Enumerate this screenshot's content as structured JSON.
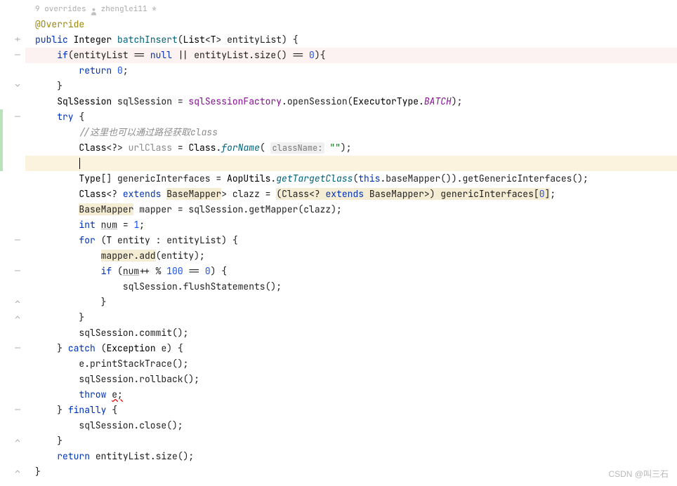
{
  "header": {
    "overrides_text": "9 overrides",
    "author": "zhenglei11 *"
  },
  "code": {
    "l1_ann": "@Override",
    "l2_kw1": "public",
    "l2_cls": "Integer",
    "l2_fn": "batchInsert",
    "l2_a": "(",
    "l2_cls2": "List",
    "l2_lt": "<",
    "l2_cls3": "T",
    "l2_gt": "> ",
    "l2_p": "entityList) {",
    "l3_a": "    ",
    "l3_kw": "if",
    "l3_b": "(entityList == ",
    "l3_null": "null",
    "l3_c": " || entityList.size() == ",
    "l3_num": "0",
    "l3_d": "){",
    "l4_a": "        ",
    "l4_kw": "return ",
    "l4_num": "0",
    "l4_sc": ";",
    "l5": "    }",
    "l6_a": "    ",
    "l6_cls": "SqlSession",
    "l6_b": " sqlSession = ",
    "l6_fld": "sqlSessionFactory",
    "l6_c": ".openSession(",
    "l6_enum": "ExecutorType",
    "l6_d": ".",
    "l6_cst": "BATCH",
    "l6_e": ");",
    "l7_a": "    ",
    "l7_kw": "try",
    "l7_b": " {",
    "l8_a": "        ",
    "l8_cmt": "//这里也可以通过路径获取class",
    "l9_a": "        ",
    "l9_cls": "Class",
    "l9_b": "<?> ",
    "l9_var": "urlClass",
    "l9_c": " = ",
    "l9_cls2": "Class",
    "l9_d": ".",
    "l9_fn": "forName",
    "l9_e": "( ",
    "l9_pn": "className:",
    "l9_sp": " ",
    "l9_str": "\"\"",
    "l9_f": ");",
    "l10_a": "        ",
    "l11_a": "        ",
    "l11_cls": "Type",
    "l11_b": "[] genericInterfaces = ",
    "l11_cls2": "AopUtils",
    "l11_c": ".",
    "l11_fn": "getTargetClass",
    "l11_d": "(",
    "l11_kw": "this",
    "l11_e": ".baseMapper()).getGenericInterfaces();",
    "l12_a": "        ",
    "l12_cls": "Class",
    "l12_b": "<? ",
    "l12_kw": "extends",
    "l12_sp": " ",
    "l12_hb": "BaseMapper",
    "l12_c": "> clazz = ",
    "l12_hb2": "(Class<? ",
    "l12_kw2": "extends",
    "l12_hb3": " BaseMapper>) genericInterfaces[",
    "l12_num": "0",
    "l12_hb4": "]",
    "l12_sc": ";",
    "l13_a": "        ",
    "l13_hb": "BaseMapper",
    "l13_b": " mapper = sqlSession.getMapper(clazz);",
    "l14_a": "        ",
    "l14_kw": "int",
    "l14_sp": " ",
    "l14_var": "num",
    "l14_b": " = ",
    "l14_num": "1",
    "l14_sc": ";",
    "l15_a": "        ",
    "l15_kw": "for",
    "l15_b": " (",
    "l15_cls": "T",
    "l15_c": " entity : entityList) {",
    "l16_a": "            ",
    "l16_hb": "mapper.add",
    "l16_b": "(entity);",
    "l17_a": "            ",
    "l17_kw": "if",
    "l17_b": " (",
    "l17_var": "num",
    "l17_c": "++ % ",
    "l17_n1": "100",
    "l17_d": " == ",
    "l17_n2": "0",
    "l17_e": ") {",
    "l18_a": "                sqlSession.flushStatements();",
    "l19": "            }",
    "l20": "        }",
    "l21": "        sqlSession.commit();",
    "l22_a": "    } ",
    "l22_kw": "catch",
    "l22_b": " (",
    "l22_cls": "Exception",
    "l22_c": " e) {",
    "l23": "        e.printStackTrace();",
    "l24": "        sqlSession.rollback();",
    "l25_a": "        ",
    "l25_kw": "throw",
    "l25_sp": " ",
    "l25_err": "e;",
    "l26_a": "    } ",
    "l26_kw": "finally",
    "l26_b": " {",
    "l27": "        sqlSession.close();",
    "l28": "    }",
    "l29_a": "    ",
    "l29_kw": "return",
    "l29_b": " entityList.size();",
    "l30": "}"
  },
  "watermark": "CSDN @叫三石"
}
